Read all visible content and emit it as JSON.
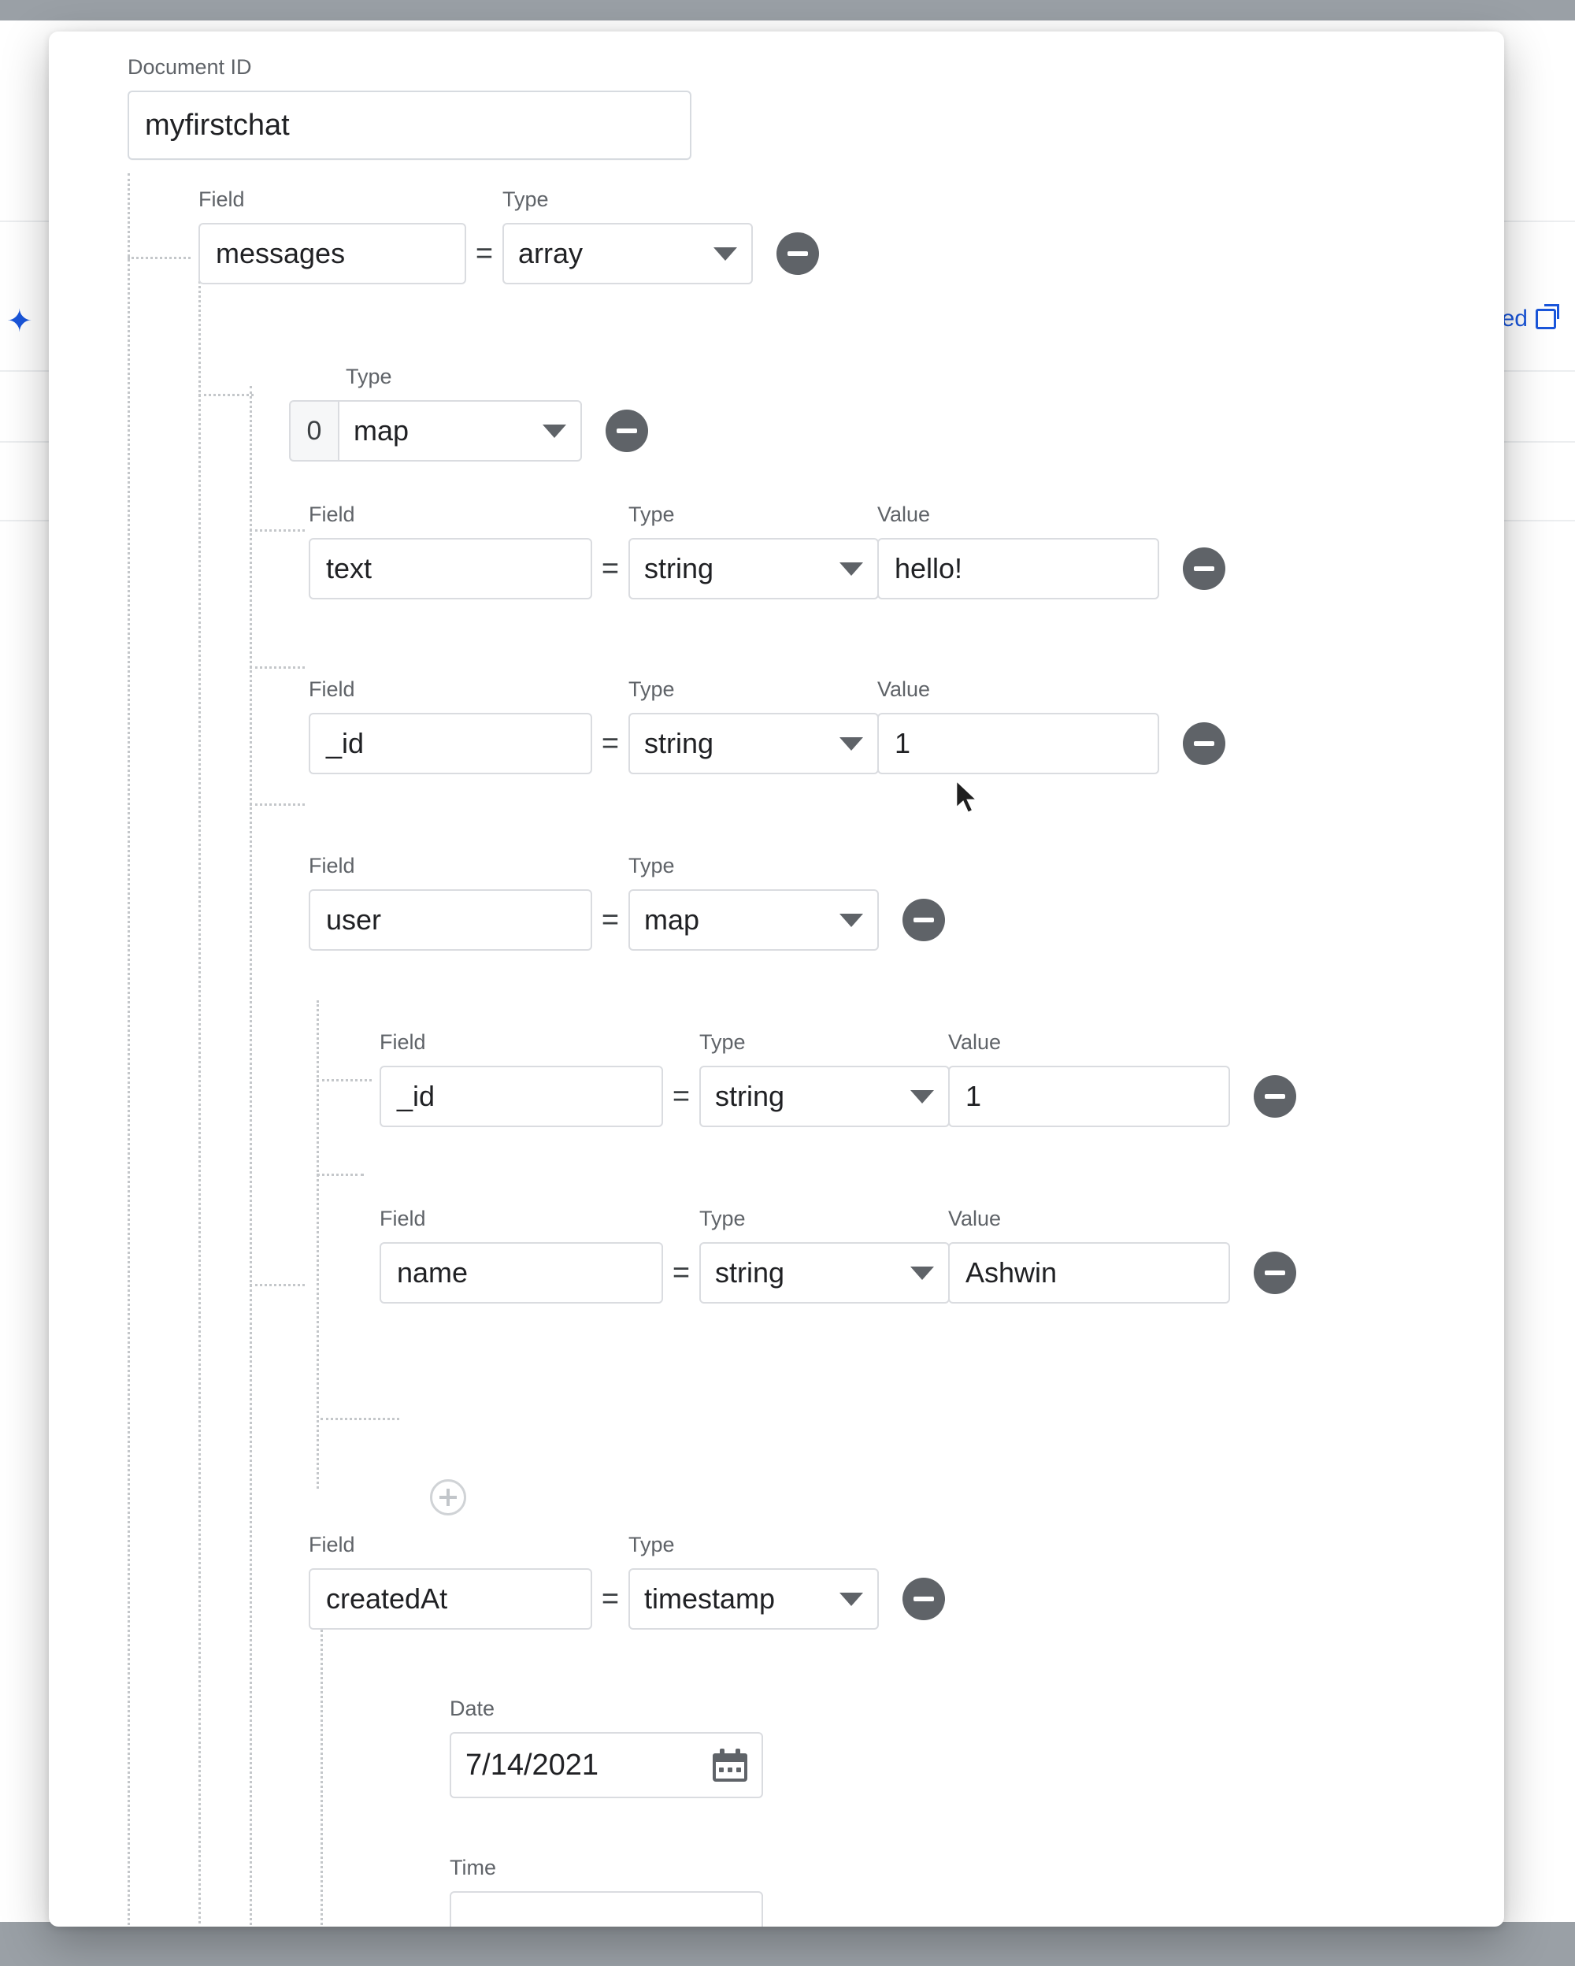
{
  "backdrop": {
    "right_link_text": "ed",
    "icons": {
      "sparkle": "sparkle-icon",
      "external_link": "external-link-icon"
    }
  },
  "modal": {
    "document_id": {
      "label": "Document ID",
      "value": "myfirstchat"
    },
    "column_headers": {
      "field": "Field",
      "type": "Type",
      "value": "Value",
      "date": "Date",
      "time": "Time"
    },
    "rows": {
      "messages": {
        "field": "messages",
        "equals": "=",
        "type": "array",
        "remove": "remove-field"
      },
      "array_item_0": {
        "index": "0",
        "type": "map",
        "remove": "remove-field"
      },
      "text": {
        "field": "text",
        "equals": "=",
        "type": "string",
        "value": "hello!",
        "remove": "remove-field"
      },
      "msg_id": {
        "field": "_id",
        "equals": "=",
        "type": "string",
        "value": "1",
        "remove": "remove-field"
      },
      "user": {
        "field": "user",
        "equals": "=",
        "type": "map",
        "remove": "remove-field"
      },
      "user_id": {
        "field": "_id",
        "equals": "=",
        "type": "string",
        "value": "1",
        "remove": "remove-field"
      },
      "user_name": {
        "field": "name",
        "equals": "=",
        "type": "string",
        "value": "Ashwin",
        "remove": "remove-field"
      },
      "add_user_field": {
        "add": "add-field"
      },
      "created_at": {
        "field": "createdAt",
        "equals": "=",
        "type": "timestamp",
        "remove": "remove-field"
      },
      "created_at_date": {
        "label": "Date",
        "value": "7/14/2021",
        "icon": "calendar-icon"
      },
      "created_at_time": {
        "label": "Time",
        "value": ""
      }
    }
  }
}
